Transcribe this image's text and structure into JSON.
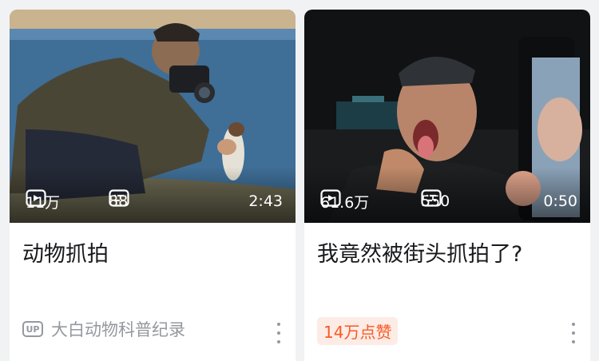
{
  "cards": [
    {
      "views": "11万",
      "danmaku": "88",
      "duration": "2:43",
      "title": "动物抓拍",
      "author_badge": "UP",
      "author": "大白动物科普纪录"
    },
    {
      "views": "61.6万",
      "danmaku": "550",
      "duration": "0:50",
      "title": "我竟然被街头抓拍了?",
      "likes": "14万点赞"
    }
  ],
  "icons": {
    "views": "play-icon",
    "danmaku": "danmaku-icon",
    "more": "more-vertical-icon"
  },
  "colors": {
    "background": "#f1f2f3",
    "text_primary": "#18191c",
    "text_secondary": "#9499a0",
    "likes_text": "#f85a24",
    "likes_bg": "#fdece6"
  }
}
